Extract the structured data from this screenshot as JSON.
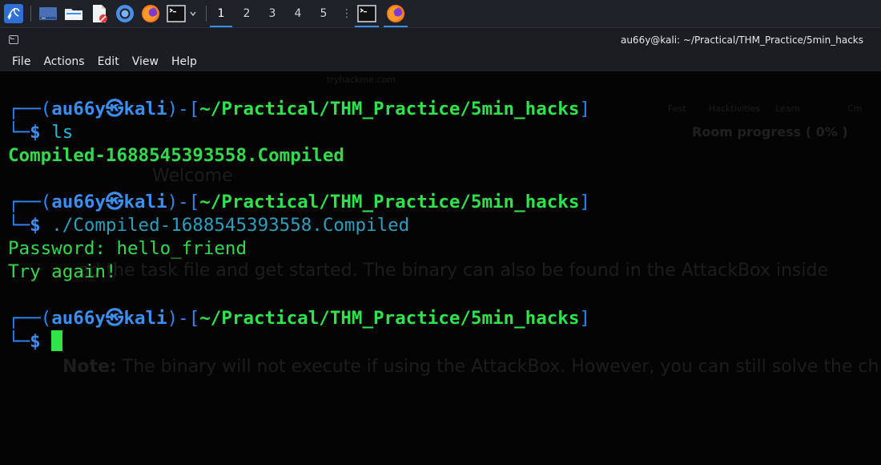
{
  "taskbar": {
    "workspaces": [
      "1",
      "2",
      "3",
      "4",
      "5"
    ],
    "active_workspace": "1"
  },
  "window": {
    "title": "au66y@kali: ~/Practical/THM_Practice/5min_hacks"
  },
  "menubar": {
    "items": [
      "File",
      "Actions",
      "Edit",
      "View",
      "Help"
    ]
  },
  "terminal": {
    "prompt": {
      "open": "┌──(",
      "user": "au66y",
      "at": "㉿",
      "host": "kali",
      "mid": ")-[",
      "path": "~/Practical/THM_Practice/5min_hacks",
      "close": "]",
      "second": "└─",
      "dollar": "$"
    },
    "commands": [
      "ls",
      "./Compiled-1688545393558.Compiled"
    ],
    "ls_output": "Compiled-1688545393558.Compiled",
    "program_output": [
      "Password: hello_friend",
      "Try again!"
    ]
  },
  "background": {
    "url": "tryhackme.com",
    "room_progress": "Room progress ( 0% )",
    "tab_labels": [
      "Fest",
      "Hacktivities",
      "Learn",
      "Cm"
    ],
    "welcome": "Welcome",
    "task_text": "ad the task file and get started. The binary can also be found in the AttackBox inside",
    "note_label": "Note:",
    "note_text": " The binary will not execute if using the AttackBox. However, you can still solve the ch"
  },
  "colors": {
    "prompt_blue": "#2e86f0",
    "path_green": "#2fe34b",
    "command_cyan": "#2a9fbf",
    "taskbar_accent": "#3a8ee6"
  }
}
